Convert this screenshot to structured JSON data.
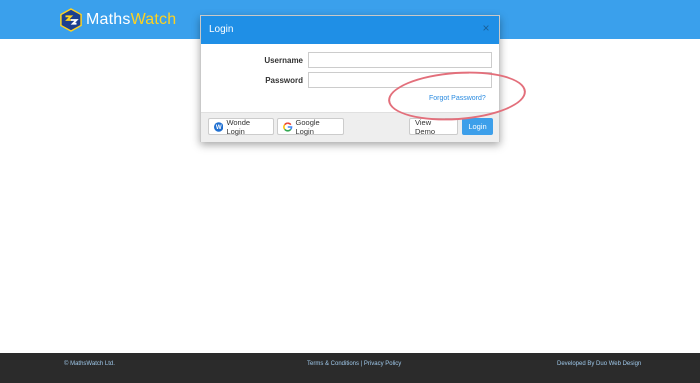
{
  "brand": {
    "name_part1": "Maths",
    "name_part2": "Watch",
    "logo_icon": "mathswatch-logo-icon",
    "accent_color": "#ffd21f",
    "bar_color": "#3aa0ec"
  },
  "modal": {
    "title": "Login",
    "close_symbol": "×",
    "username_label": "Username",
    "password_label": "Password",
    "username_value": "",
    "password_value": "",
    "forgot_label": "Forgot Password?",
    "buttons": {
      "wonde": "Wonde Login",
      "google": "Google Login",
      "demo": "View Demo",
      "login": "Login"
    },
    "header_color": "#1f8fe6"
  },
  "footer": {
    "copyright": "© MathsWatch Ltd.",
    "links": "Terms & Conditions | Privacy Policy",
    "developer": "Developed By Duo Web Design",
    "bg_color": "#2b2b2b"
  }
}
